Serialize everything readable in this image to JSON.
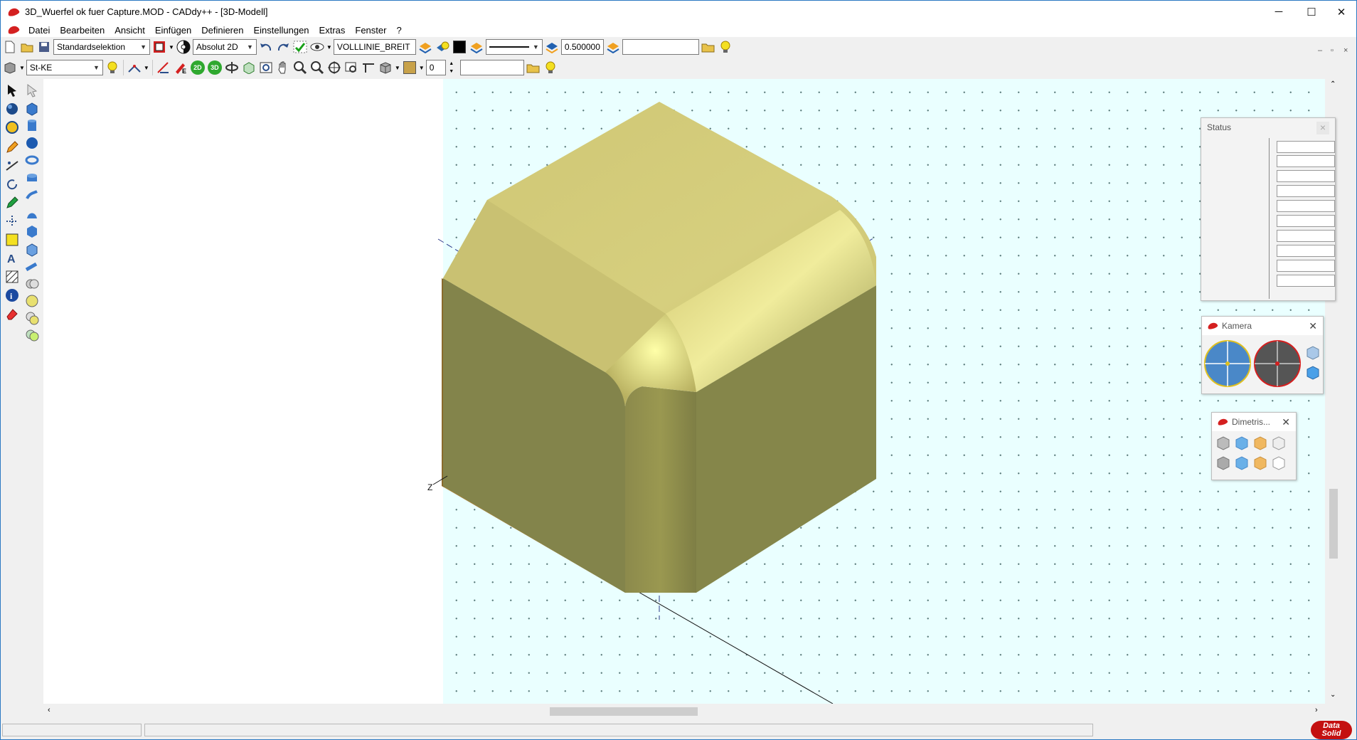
{
  "window": {
    "title": "3D_Wuerfel ok fuer Capture.MOD  -  CADdy++ - [3D-Modell]",
    "controls": {
      "minimize": "─",
      "maximize": "☐",
      "close": "✕"
    },
    "mdi_controls": {
      "minimize": "–",
      "restore": "▫",
      "close": "×"
    }
  },
  "menu": [
    "Datei",
    "Bearbeiten",
    "Ansicht",
    "Einfügen",
    "Definieren",
    "Einstellungen",
    "Extras",
    "Fenster",
    "?"
  ],
  "toolbar1": {
    "selection_mode": "Standardselektion",
    "coord_mode": "Absolut 2D",
    "linetype": "VOLLLINIE_BREIT",
    "linewidth": "0.500000",
    "extra_field": "",
    "color_swatch": "#000000"
  },
  "toolbar2": {
    "layer": "St-KE",
    "view2d_label": "2D",
    "view3d_label": "3D",
    "layer_number": "0",
    "extra_field": "",
    "color_swatch": "#c8a24a"
  },
  "panels": {
    "status": {
      "title": "Status",
      "close": "×",
      "row_count": 10
    },
    "camera": {
      "title": "Kamera",
      "close": "✕"
    },
    "dimetric": {
      "title": "Dimetris...",
      "close": "✕"
    }
  },
  "axis_label": "Z",
  "brand": {
    "line1": "Data",
    "line2": "Solid"
  },
  "colors": {
    "canvas_bg": "#eaffff",
    "cube_top": "#d2c878",
    "cube_left": "#858549",
    "cube_right": "#85864b",
    "accent_red": "#d42020"
  }
}
